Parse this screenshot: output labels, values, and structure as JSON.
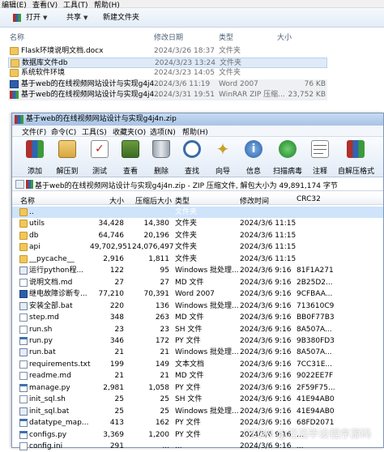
{
  "explorer": {
    "menu": [
      "编辑(E)",
      "查看(V)",
      "工具(T)",
      "帮助(H)"
    ],
    "toolbar": {
      "open": "打开",
      "share": "共享",
      "new_folder": "新建文件夹"
    },
    "columns": {
      "name": "名称",
      "date": "修改日期",
      "type": "类型",
      "size": "大小"
    },
    "files": [
      {
        "name": "Flask环境说明文档.docx",
        "date": "2024/3/26 18:37",
        "type": "文件夹",
        "size": "",
        "icon": "folder"
      },
      {
        "name": "数据库文件db",
        "date": "2024/3/23 13:24",
        "type": "文件夹",
        "size": "",
        "icon": "folder"
      },
      {
        "name": "系统软件环境",
        "date": "2024/3/23 14:05",
        "type": "文件夹",
        "size": "",
        "icon": "folder"
      },
      {
        "name": "基于web的在线视频网站设计与实现g4j4...",
        "date": "2024/3/6 11:19",
        "type": "Word 2007",
        "size": "76 KB",
        "icon": "docx"
      },
      {
        "name": "基于web的在线视频网站设计与实现g4j4...",
        "date": "2024/3/31 19:51",
        "type": "WinRAR ZIP 压缩...",
        "size": "23,752 KB",
        "icon": "rar"
      }
    ]
  },
  "winrar": {
    "title": "基于web的在线视频网站设计与实现g4j4n.zip",
    "menu": [
      "文件(F)",
      "命令(C)",
      "工具(S)",
      "收藏夹(O)",
      "选项(N)",
      "帮助(H)"
    ],
    "tools": [
      "添加",
      "解压到",
      "测试",
      "查看",
      "删除",
      "查找",
      "向导",
      "信息",
      "扫描病毒",
      "注释",
      "自解压格式"
    ],
    "archive_info": "基于web的在线视频网站设计与实现g4j4n.zip - ZIP 压缩文件, 解包大小为 49,891,174 字节",
    "columns": [
      "名称",
      "大小",
      "压缩后大小",
      "类型",
      "修改时间",
      "CRC32"
    ],
    "rows": [
      {
        "name": "..",
        "size": "",
        "packed": "",
        "type": "文件夹",
        "modified": "",
        "crc": "",
        "icon": "folder"
      },
      {
        "name": "utils",
        "size": "34,428",
        "packed": "14,380",
        "type": "文件夹",
        "modified": "2024/3/6 11:15",
        "crc": "",
        "icon": "folder"
      },
      {
        "name": "db",
        "size": "64,746",
        "packed": "20,196",
        "type": "文件夹",
        "modified": "2024/3/6 11:15",
        "crc": "",
        "icon": "folder"
      },
      {
        "name": "api",
        "size": "49,702,951",
        "packed": "24,076,497",
        "type": "文件夹",
        "modified": "2024/3/6 11:15",
        "crc": "",
        "icon": "folder"
      },
      {
        "name": "__pycache__",
        "size": "2,916",
        "packed": "1,811",
        "type": "文件夹",
        "modified": "2024/3/6 11:15",
        "crc": "",
        "icon": "folder"
      },
      {
        "name": "运行python程...",
        "size": "122",
        "packed": "95",
        "type": "Windows 批处理...",
        "modified": "2024/3/6 9:16",
        "crc": "81F1A271",
        "icon": "bat"
      },
      {
        "name": "说明文档.md",
        "size": "27",
        "packed": "27",
        "type": "MD 文件",
        "modified": "2024/3/6 9:16",
        "crc": "2B25D2...",
        "icon": "file"
      },
      {
        "name": "继电故障诊断专...",
        "size": "77,210",
        "packed": "70,391",
        "type": "Word 2007",
        "modified": "2024/3/6 9:16",
        "crc": "9CFBAA...",
        "icon": "word"
      },
      {
        "name": "安装全部.bat",
        "size": "220",
        "packed": "136",
        "type": "Windows 批处理...",
        "modified": "2024/3/6 9:16",
        "crc": "713610C9",
        "icon": "bat"
      },
      {
        "name": "step.md",
        "size": "348",
        "packed": "263",
        "type": "MD 文件",
        "modified": "2024/3/6 9:16",
        "crc": "BB0F77B3",
        "icon": "file"
      },
      {
        "name": "run.sh",
        "size": "23",
        "packed": "23",
        "type": "SH 文件",
        "modified": "2024/3/6 9:16",
        "crc": "8A507A...",
        "icon": "file"
      },
      {
        "name": "run.py",
        "size": "346",
        "packed": "172",
        "type": "PY 文件",
        "modified": "2024/3/6 9:16",
        "crc": "9B380FD3",
        "icon": "py"
      },
      {
        "name": "run.bat",
        "size": "21",
        "packed": "21",
        "type": "Windows 批处理...",
        "modified": "2024/3/6 9:16",
        "crc": "8A507A...",
        "icon": "bat"
      },
      {
        "name": "requirements.txt",
        "size": "199",
        "packed": "149",
        "type": "文本文档",
        "modified": "2024/3/6 9:16",
        "crc": "7CC31E...",
        "icon": "file"
      },
      {
        "name": "readme.md",
        "size": "21",
        "packed": "21",
        "type": "MD 文件",
        "modified": "2024/3/6 9:16",
        "crc": "9022EE7F",
        "icon": "file"
      },
      {
        "name": "manage.py",
        "size": "2,981",
        "packed": "1,058",
        "type": "PY 文件",
        "modified": "2024/3/6 9:16",
        "crc": "2F59F75...",
        "icon": "py"
      },
      {
        "name": "init_sql.sh",
        "size": "25",
        "packed": "25",
        "type": "SH 文件",
        "modified": "2024/3/6 9:16",
        "crc": "41E94AB0",
        "icon": "file"
      },
      {
        "name": "init_sql.bat",
        "size": "25",
        "packed": "25",
        "type": "Windows 批处理...",
        "modified": "2024/3/6 9:16",
        "crc": "41E94AB0",
        "icon": "bat"
      },
      {
        "name": "datatype_map...",
        "size": "413",
        "packed": "162",
        "type": "PY 文件",
        "modified": "2024/3/6 9:16",
        "crc": "68FD2071",
        "icon": "py"
      },
      {
        "name": "configs.py",
        "size": "3,369",
        "packed": "1,200",
        "type": "PY 文件",
        "modified": "2024/3/6 9:16",
        "crc": "...",
        "icon": "py"
      },
      {
        "name": "config.ini",
        "size": "291",
        "packed": "...",
        "type": "...",
        "modified": "2024/3/6 9:16",
        "crc": "...",
        "icon": "file"
      }
    ]
  },
  "watermark": "CSDN @滔滔毕设程序源码"
}
